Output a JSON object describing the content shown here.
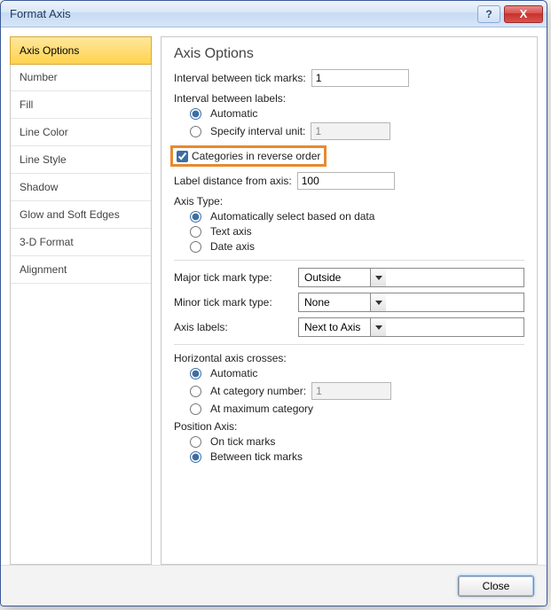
{
  "window": {
    "title": "Format Axis",
    "help_tooltip": "?",
    "close_tooltip": "X"
  },
  "sidebar": {
    "items": [
      "Axis Options",
      "Number",
      "Fill",
      "Line Color",
      "Line Style",
      "Shadow",
      "Glow and Soft Edges",
      "3-D Format",
      "Alignment"
    ],
    "selected_index": 0
  },
  "panel": {
    "heading": "Axis Options",
    "interval_between_tick_marks_label": "Interval between tick marks:",
    "interval_between_tick_marks_value": "1",
    "interval_between_labels_label": "Interval between labels:",
    "interval_automatic": "Automatic",
    "interval_specify_label": "Specify interval unit:",
    "interval_specify_value": "1",
    "interval_specify_disabled": true,
    "interval_selected": "automatic",
    "categories_reverse_label": "Categories in reverse order",
    "categories_reverse_checked": true,
    "label_distance_label": "Label distance from axis:",
    "label_distance_value": "100",
    "axis_type_label": "Axis Type:",
    "axis_type_auto": "Automatically select based on data",
    "axis_type_text": "Text axis",
    "axis_type_date": "Date axis",
    "axis_type_selected": "auto",
    "major_tick_label": "Major tick mark type:",
    "major_tick_value": "Outside",
    "minor_tick_label": "Minor tick mark type:",
    "minor_tick_value": "None",
    "axis_labels_label": "Axis labels:",
    "axis_labels_value": "Next to Axis",
    "hcross_label": "Horizontal axis crosses:",
    "hcross_auto": "Automatic",
    "hcross_cat_label": "At category number:",
    "hcross_cat_value": "1",
    "hcross_cat_disabled": true,
    "hcross_max": "At maximum category",
    "hcross_selected": "automatic",
    "pos_axis_label": "Position Axis:",
    "pos_on_ticks": "On tick marks",
    "pos_between": "Between tick marks",
    "pos_selected": "between"
  },
  "footer": {
    "close_label": "Close"
  }
}
